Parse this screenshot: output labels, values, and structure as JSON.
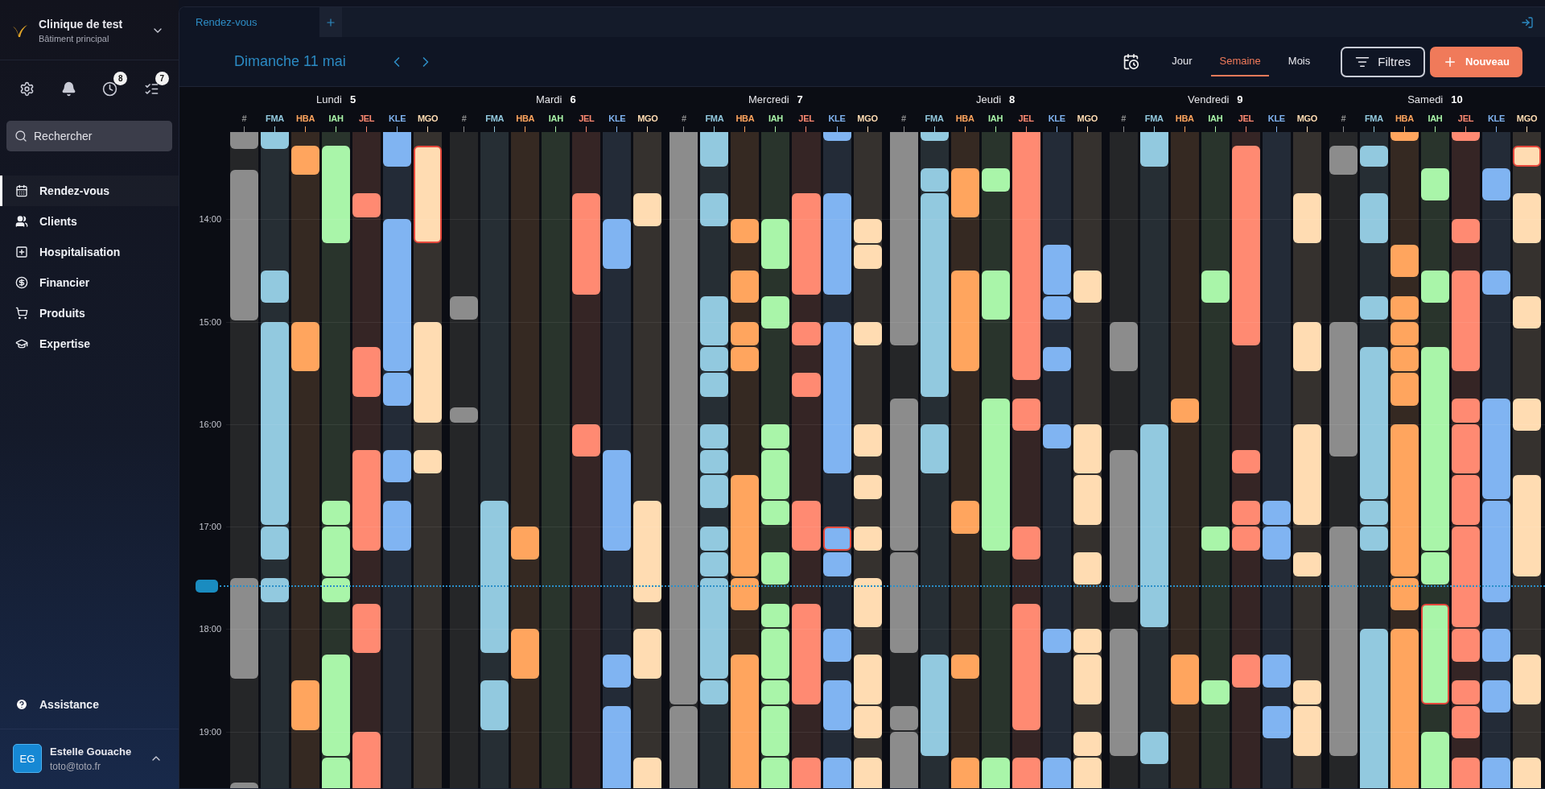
{
  "clinic": {
    "name": "Clinique de test",
    "building": "Bâtiment principal"
  },
  "toolbar_icons": [
    {
      "kind": "settings"
    },
    {
      "kind": "bell"
    },
    {
      "kind": "clock",
      "badge": "8"
    },
    {
      "kind": "tasks",
      "badge": "7"
    }
  ],
  "search": {
    "placeholder": "Rechercher"
  },
  "nav": [
    {
      "kind": "calendar",
      "label": "Rendez-vous",
      "selected": true
    },
    {
      "kind": "users",
      "label": "Clients",
      "selected": false
    },
    {
      "kind": "hospital",
      "label": "Hospitalisation",
      "selected": false
    },
    {
      "kind": "money",
      "label": "Financier",
      "selected": false
    },
    {
      "kind": "cart",
      "label": "Produits",
      "selected": false
    },
    {
      "kind": "school",
      "label": "Expertise",
      "selected": false
    }
  ],
  "assistance": "Assistance",
  "user": {
    "initials": "EG",
    "name": "Estelle Gouache",
    "email": "toto@toto.fr"
  },
  "tabs": [
    {
      "label": "Rendez-vous",
      "selected": true
    }
  ],
  "date_title": "Dimanche 11 mai",
  "views": [
    {
      "label": "Jour",
      "selected": false
    },
    {
      "label": "Semaine",
      "selected": true
    },
    {
      "label": "Mois",
      "selected": false
    }
  ],
  "filters_button": "Filtres",
  "new_button": "Nouveau",
  "hours": [
    "14:00",
    "15:00",
    "16:00",
    "17:00",
    "18:00",
    "19:00"
  ],
  "days": [
    {
      "name": "Lundi",
      "date": "5",
      "columns": [
        {
          "code": "#",
          "color": "#8c8c8c"
        },
        {
          "code": "FMA",
          "color": "#92c9df"
        },
        {
          "code": "HBA",
          "color": "#ffa55e"
        },
        {
          "code": "IAH",
          "color": "#a9f5a9"
        },
        {
          "code": "JEL",
          "color": "#ff8a72"
        },
        {
          "code": "KLE",
          "color": "#80b4f2"
        },
        {
          "code": "MGO",
          "color": "#ffdcb2"
        }
      ]
    },
    {
      "name": "Mardi",
      "date": "6",
      "columns": [
        {
          "code": "#",
          "color": "#8c8c8c"
        },
        {
          "code": "FMA",
          "color": "#92c9df"
        },
        {
          "code": "HBA",
          "color": "#ffa55e"
        },
        {
          "code": "IAH",
          "color": "#a9f5a9"
        },
        {
          "code": "JEL",
          "color": "#ff8a72"
        },
        {
          "code": "KLE",
          "color": "#80b4f2"
        },
        {
          "code": "MGO",
          "color": "#ffdcb2"
        }
      ]
    },
    {
      "name": "Mercredi",
      "date": "7",
      "columns": [
        {
          "code": "#",
          "color": "#8c8c8c"
        },
        {
          "code": "FMA",
          "color": "#92c9df"
        },
        {
          "code": "HBA",
          "color": "#ffa55e"
        },
        {
          "code": "IAH",
          "color": "#a9f5a9"
        },
        {
          "code": "JEL",
          "color": "#ff8a72"
        },
        {
          "code": "KLE",
          "color": "#80b4f2"
        },
        {
          "code": "MGO",
          "color": "#ffdcb2"
        }
      ]
    },
    {
      "name": "Jeudi",
      "date": "8",
      "columns": [
        {
          "code": "#",
          "color": "#8c8c8c"
        },
        {
          "code": "FMA",
          "color": "#92c9df"
        },
        {
          "code": "HBA",
          "color": "#ffa55e"
        },
        {
          "code": "IAH",
          "color": "#a9f5a9"
        },
        {
          "code": "JEL",
          "color": "#ff8a72"
        },
        {
          "code": "KLE",
          "color": "#80b4f2"
        },
        {
          "code": "MGO",
          "color": "#ffdcb2"
        }
      ]
    },
    {
      "name": "Vendredi",
      "date": "9",
      "columns": [
        {
          "code": "#",
          "color": "#8c8c8c"
        },
        {
          "code": "FMA",
          "color": "#92c9df"
        },
        {
          "code": "HBA",
          "color": "#ffa55e"
        },
        {
          "code": "IAH",
          "color": "#a9f5a9"
        },
        {
          "code": "JEL",
          "color": "#ff8a72"
        },
        {
          "code": "KLE",
          "color": "#80b4f2"
        },
        {
          "code": "MGO",
          "color": "#ffdcb2"
        }
      ]
    },
    {
      "name": "Samedi",
      "date": "10",
      "columns": [
        {
          "code": "#",
          "color": "#8c8c8c"
        },
        {
          "code": "FMA",
          "color": "#92c9df"
        },
        {
          "code": "HBA",
          "color": "#ffa55e"
        },
        {
          "code": "IAH",
          "color": "#a9f5a9"
        },
        {
          "code": "JEL",
          "color": "#ff8a72"
        },
        {
          "code": "KLE",
          "color": "#80b4f2"
        },
        {
          "code": "MGO",
          "color": "#ffdcb2"
        }
      ]
    }
  ]
}
